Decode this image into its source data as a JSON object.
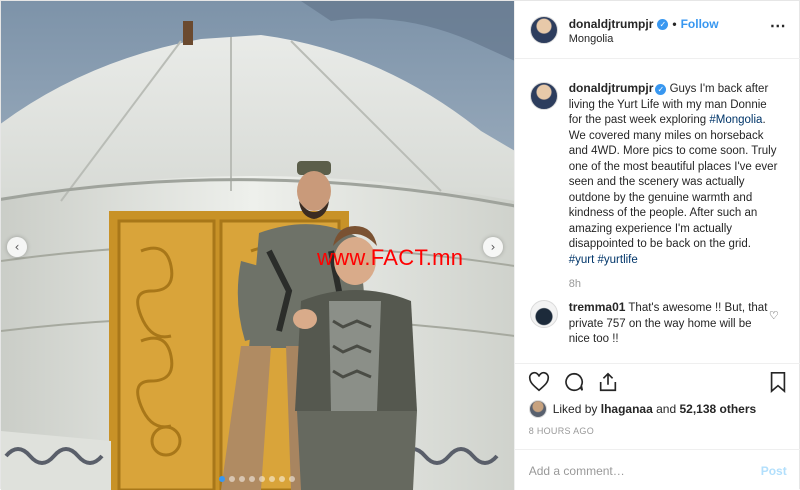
{
  "author": {
    "username": "donaldjtrumpjr",
    "location": "Mongolia",
    "follow_label": "Follow",
    "separator": "•",
    "verified_icon": "verified-badge-icon"
  },
  "photo": {
    "watermark": "www.FACT.mn",
    "slide_count": 8,
    "active_slide": 1,
    "prev_arrow": "‹",
    "next_arrow": "›"
  },
  "caption": {
    "username": "donaldjtrumpjr",
    "text_1": " Guys I'm back after living the Yurt Life with my man Donnie for the past week exploring ",
    "tag_1": "#Mongolia",
    "text_2": ". We covered many miles on horseback and 4WD. More pics to come soon. Truly one of the most beautiful places I've ever seen and the scenery was actually outdone by the genuine warmth and kindness of the people. After such an amazing experience I'm actually disappointed to be back on the grid. ",
    "tag_2": "#yurt",
    "tag_3": "#yurtlife",
    "time": "8h"
  },
  "comment": {
    "username": "tremma01",
    "text": " That's awesome !! But, that private 757 on the way home will be nice too !!"
  },
  "likes": {
    "prefix": "Liked by ",
    "user": "lhaganaa",
    "middle": " and ",
    "count": "52,138 others"
  },
  "timestamp": "8 HOURS AGO",
  "add_comment": {
    "placeholder": "Add a comment…",
    "post_label": "Post"
  },
  "colors": {
    "link_blue": "#3897f0",
    "hashtag": "#003569",
    "watermark": "#ff0000"
  }
}
